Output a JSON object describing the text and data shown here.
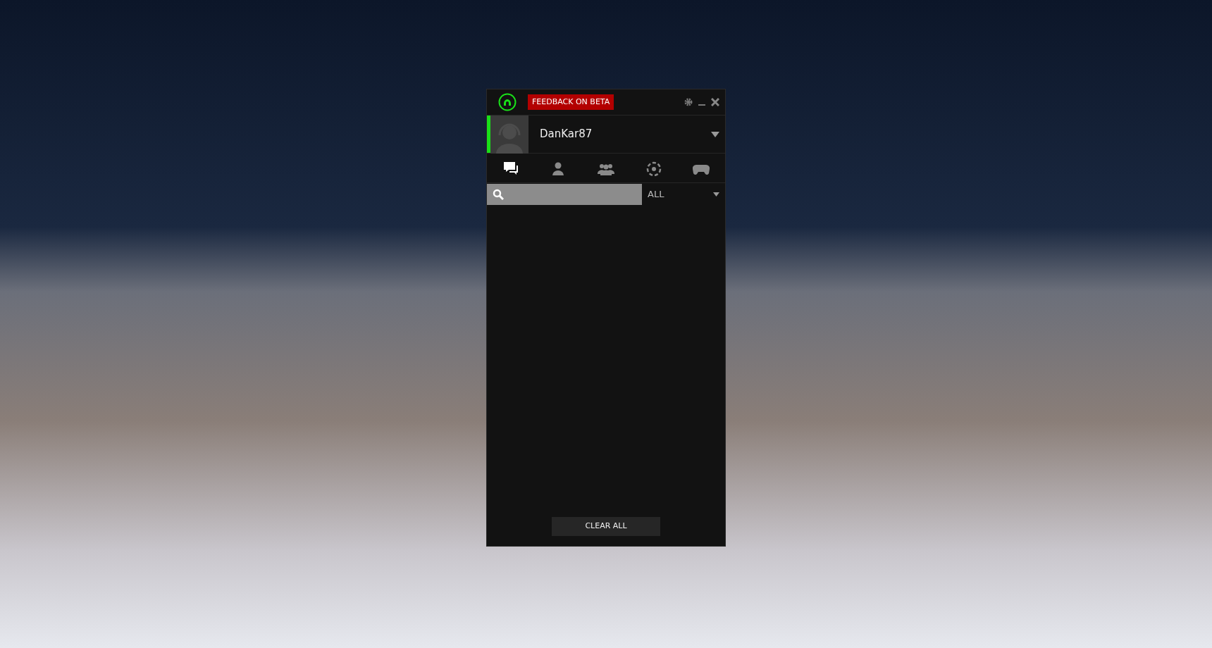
{
  "window": {
    "feedback_label": "FEEDBACK ON BETA"
  },
  "user": {
    "name": "DanKar87",
    "online": true
  },
  "tabs": [
    {
      "kind": "chats",
      "selected": true
    },
    {
      "kind": "contact",
      "selected": false
    },
    {
      "kind": "groups",
      "selected": false
    },
    {
      "kind": "community",
      "selected": false
    },
    {
      "kind": "games",
      "selected": false
    }
  ],
  "filter": {
    "value": "ALL"
  },
  "clear_button": "CLEAR ALL"
}
